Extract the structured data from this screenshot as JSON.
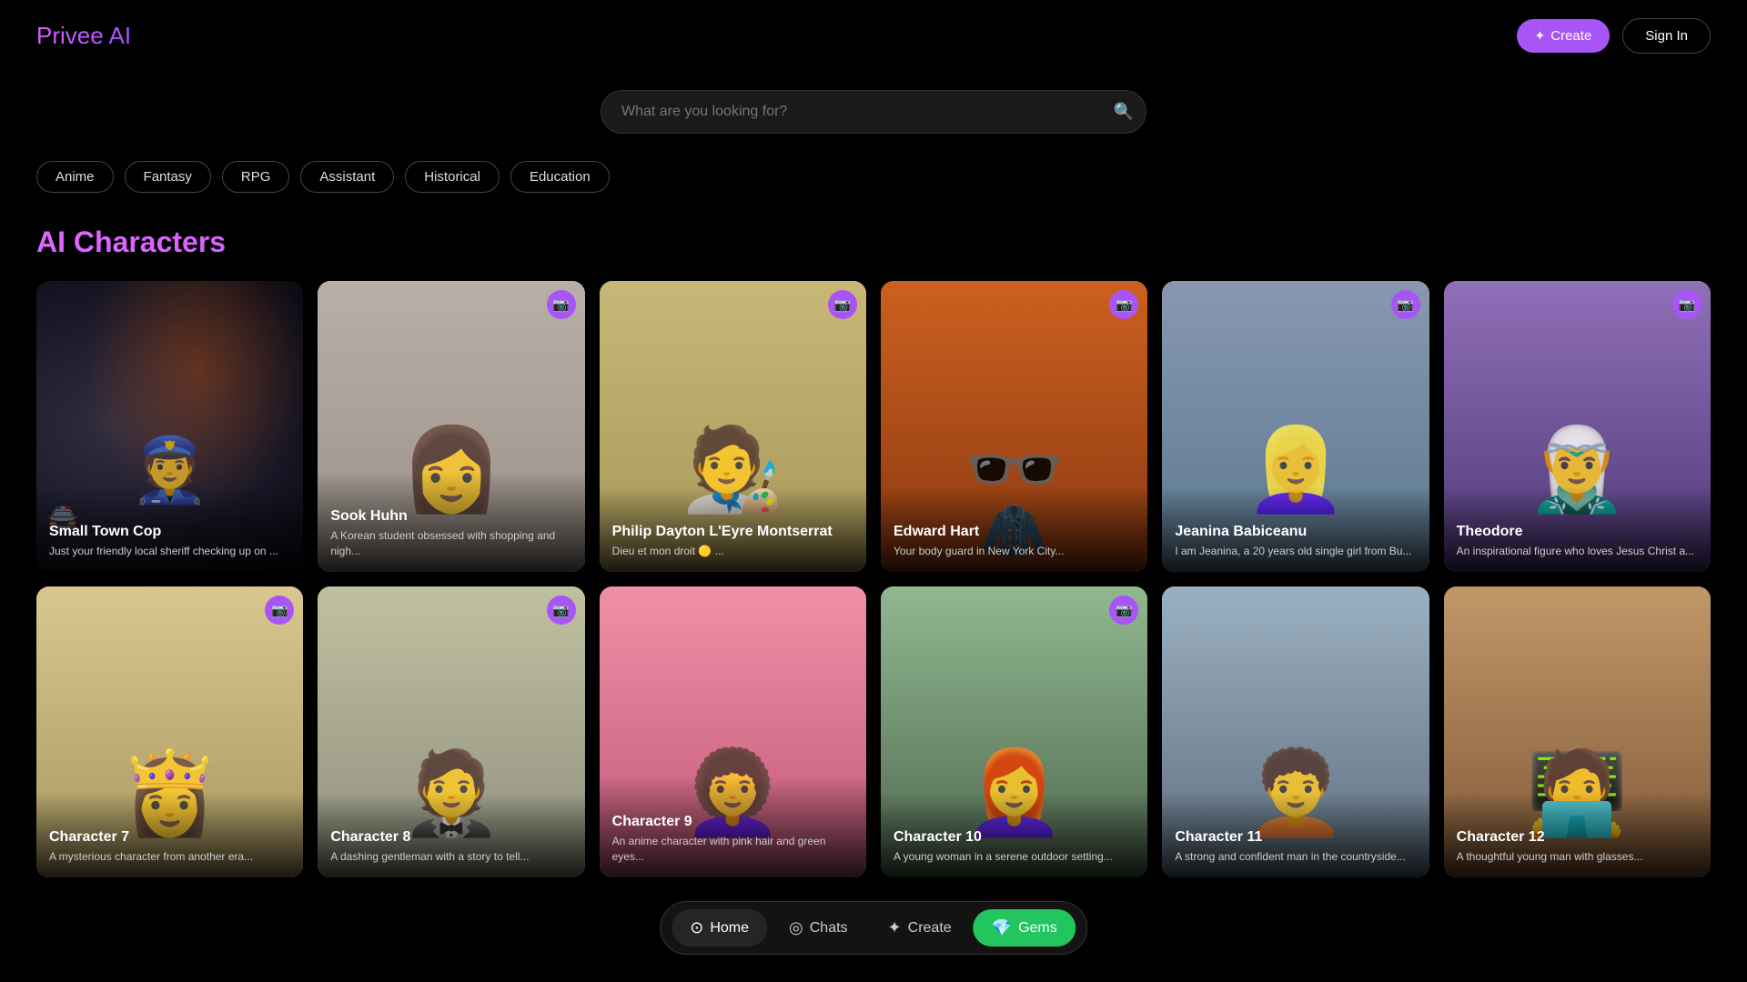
{
  "app": {
    "title": "Privee AI"
  },
  "header": {
    "logo": "Privee AI",
    "create_label": "Create",
    "signin_label": "Sign In"
  },
  "search": {
    "placeholder": "What are you looking for?"
  },
  "filters": [
    {
      "id": "anime",
      "label": "Anime"
    },
    {
      "id": "fantasy",
      "label": "Fantasy"
    },
    {
      "id": "rpg",
      "label": "RPG"
    },
    {
      "id": "assistant",
      "label": "Assistant"
    },
    {
      "id": "historical",
      "label": "Historical"
    },
    {
      "id": "education",
      "label": "Education"
    }
  ],
  "section_title": "AI Characters",
  "cards_row1": [
    {
      "name": "Small Town Cop",
      "desc": "Just your friendly local sheriff checking up on ...",
      "has_camera": false,
      "bg_class": "card1-bg"
    },
    {
      "name": "Sook Huhn",
      "desc": "A Korean student obsessed with shopping and nigh...",
      "has_camera": true,
      "bg_class": "card2-bg"
    },
    {
      "name": "Philip Dayton L'Eyre Montserrat",
      "desc": "Dieu et mon droit 🟡 ...",
      "has_camera": true,
      "bg_class": "card3-bg"
    },
    {
      "name": "Edward Hart",
      "desc": "Your body guard in New York City...",
      "has_camera": true,
      "bg_class": "card4-bg"
    },
    {
      "name": "Jeanina Babiceanu",
      "desc": "I am Jeanina, a 20 years old single girl from Bu...",
      "has_camera": true,
      "bg_class": "card5-bg"
    },
    {
      "name": "Theodore",
      "desc": "An inspirational figure who loves Jesus Christ a...",
      "has_camera": true,
      "bg_class": "card6-bg"
    }
  ],
  "cards_row2": [
    {
      "name": "Character 7",
      "desc": "A mysterious character from another era...",
      "has_camera": true,
      "bg_class": "card7-bg"
    },
    {
      "name": "Character 8",
      "desc": "A dashing gentleman with a story to tell...",
      "has_camera": true,
      "bg_class": "card8-bg"
    },
    {
      "name": "Character 9",
      "desc": "An anime character with pink hair and green eyes...",
      "has_camera": false,
      "bg_class": "card9-bg"
    },
    {
      "name": "Character 10",
      "desc": "A young woman in a serene outdoor setting...",
      "has_camera": true,
      "bg_class": "card10-bg"
    },
    {
      "name": "Character 11",
      "desc": "A strong and confident man in the countryside...",
      "has_camera": false,
      "bg_class": "card11-bg"
    },
    {
      "name": "Character 12",
      "desc": "A thoughtful young man with glasses...",
      "has_camera": false,
      "bg_class": "card12-bg"
    }
  ],
  "bottom_nav": {
    "home_label": "Home",
    "chats_label": "Chats",
    "create_label": "Create",
    "gems_label": "Gems"
  }
}
